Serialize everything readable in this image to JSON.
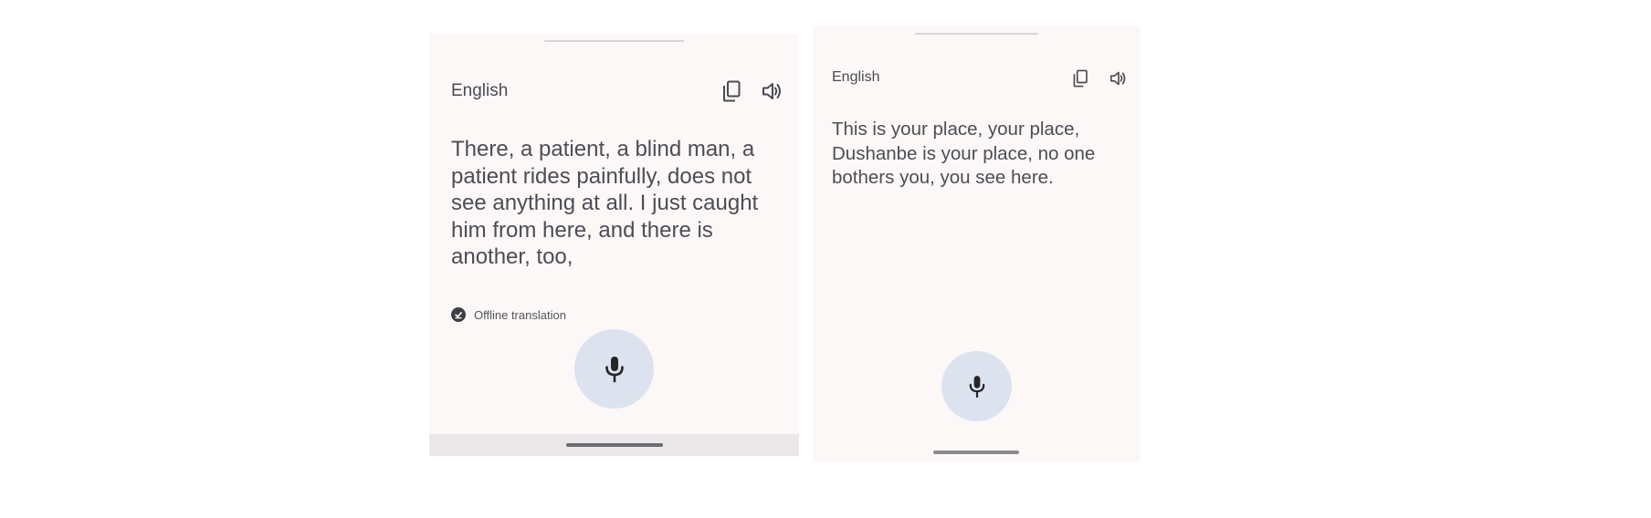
{
  "left_panel": {
    "language": "English",
    "translation": "There, a patient, a blind man, a patient rides painfully, does not see anything at all. I just caught him from here, and there is another, too,",
    "offline_label": "Offline translation",
    "icons": {
      "copy": "copy-icon",
      "speak": "speaker-icon",
      "offline": "check-circle-icon",
      "mic": "microphone-icon"
    }
  },
  "right_panel": {
    "language": "English",
    "translation": "This is your place, your place, Dushanbe is your place, no one bothers you, you see here.",
    "icons": {
      "copy": "copy-icon",
      "speak": "speaker-icon",
      "mic": "microphone-icon"
    }
  },
  "colors": {
    "panel_background": "#fcf8f8",
    "mic_button": "#dce3ef",
    "text": "#4d4d55"
  }
}
